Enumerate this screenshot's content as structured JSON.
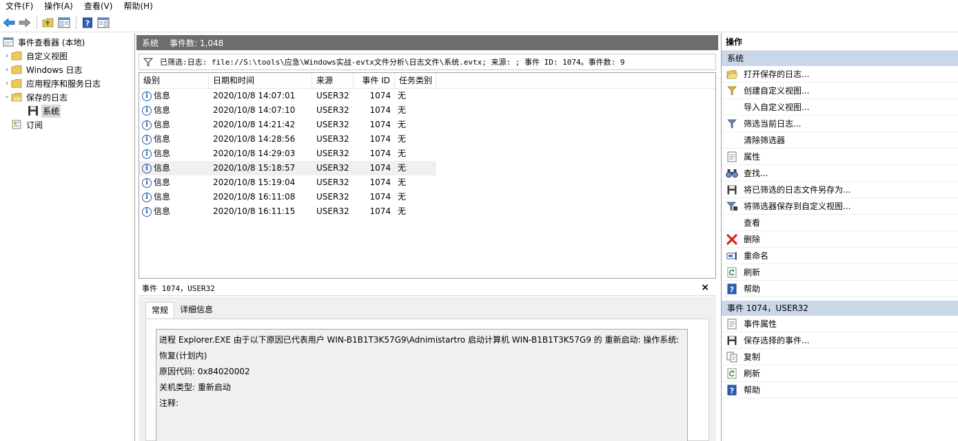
{
  "menu": [
    "文件(F)",
    "操作(A)",
    "查看(V)",
    "帮助(H)"
  ],
  "tree": {
    "root": "事件查看器 (本地)",
    "items": [
      {
        "label": "自定义视图"
      },
      {
        "label": "Windows 日志"
      },
      {
        "label": "应用程序和服务日志"
      },
      {
        "label": "保存的日志"
      },
      {
        "label": "系统"
      },
      {
        "label": "订阅"
      }
    ]
  },
  "center": {
    "title": "系统",
    "count": "事件数: 1,048",
    "filter": "已筛选:日志: file://S:\\tools\\应急\\Windows实战-evtx文件分析\\日志文件\\系统.evtx; 来源: ; 事件 ID: 1074。事件数: 9"
  },
  "grid": {
    "columns": [
      "级别",
      "日期和时间",
      "来源",
      "事件 ID",
      "任务类别"
    ],
    "rows": [
      {
        "level": "信息",
        "date": "2020/10/8 14:07:01",
        "source": "USER32",
        "id": "1074",
        "task": "无"
      },
      {
        "level": "信息",
        "date": "2020/10/8 14:07:10",
        "source": "USER32",
        "id": "1074",
        "task": "无"
      },
      {
        "level": "信息",
        "date": "2020/10/8 14:21:42",
        "source": "USER32",
        "id": "1074",
        "task": "无"
      },
      {
        "level": "信息",
        "date": "2020/10/8 14:28:56",
        "source": "USER32",
        "id": "1074",
        "task": "无"
      },
      {
        "level": "信息",
        "date": "2020/10/8 14:29:03",
        "source": "USER32",
        "id": "1074",
        "task": "无"
      },
      {
        "level": "信息",
        "date": "2020/10/8 15:18:57",
        "source": "USER32",
        "id": "1074",
        "task": "无"
      },
      {
        "level": "信息",
        "date": "2020/10/8 15:19:04",
        "source": "USER32",
        "id": "1074",
        "task": "无"
      },
      {
        "level": "信息",
        "date": "2020/10/8 16:11:08",
        "source": "USER32",
        "id": "1074",
        "task": "无"
      },
      {
        "level": "信息",
        "date": "2020/10/8 16:11:15",
        "source": "USER32",
        "id": "1074",
        "task": "无"
      }
    ]
  },
  "detail": {
    "title": "事件 1074，USER32",
    "close": "×",
    "tabs": [
      "常规",
      "详细信息"
    ],
    "lines": [
      "进程 Explorer.EXE 由于以下原因已代表用户 WIN-B1B1T3K57G9\\Adnimistartro 启动计算机 WIN-B1B1T3K57G9 的 重新启动: 操作系统: 恢复(计划内)",
      "原因代码: 0x84020002",
      "关机类型: 重新启动",
      "注释:"
    ]
  },
  "actions": {
    "title": "操作",
    "section1": "系统",
    "items1": [
      {
        "label": "打开保存的日志...",
        "icon": "folder-open-icon"
      },
      {
        "label": "创建自定义视图...",
        "icon": "filter-create-icon"
      },
      {
        "label": "导入自定义视图...",
        "icon": ""
      },
      {
        "label": "筛选当前日志...",
        "icon": "filter-icon"
      },
      {
        "label": "清除筛选器",
        "icon": ""
      },
      {
        "label": "属性",
        "icon": "properties-icon"
      },
      {
        "label": "查找...",
        "icon": "binoculars-icon"
      },
      {
        "label": "将已筛选的日志文件另存为...",
        "icon": "save-icon"
      },
      {
        "label": "将筛选器保存到自定义视图...",
        "icon": "filter-save-icon"
      },
      {
        "label": "查看",
        "icon": ""
      },
      {
        "label": "删除",
        "icon": "delete-icon"
      },
      {
        "label": "重命名",
        "icon": "rename-icon"
      },
      {
        "label": "刷新",
        "icon": "refresh-icon"
      },
      {
        "label": "帮助",
        "icon": "help-icon"
      }
    ],
    "section2": "事件 1074，USER32",
    "items2": [
      {
        "label": "事件属性",
        "icon": "properties-icon"
      },
      {
        "label": "保存选择的事件...",
        "icon": "save-icon"
      },
      {
        "label": "复制",
        "icon": "copy-icon"
      },
      {
        "label": "刷新",
        "icon": "refresh-icon"
      },
      {
        "label": "帮助",
        "icon": "help-icon"
      }
    ]
  }
}
